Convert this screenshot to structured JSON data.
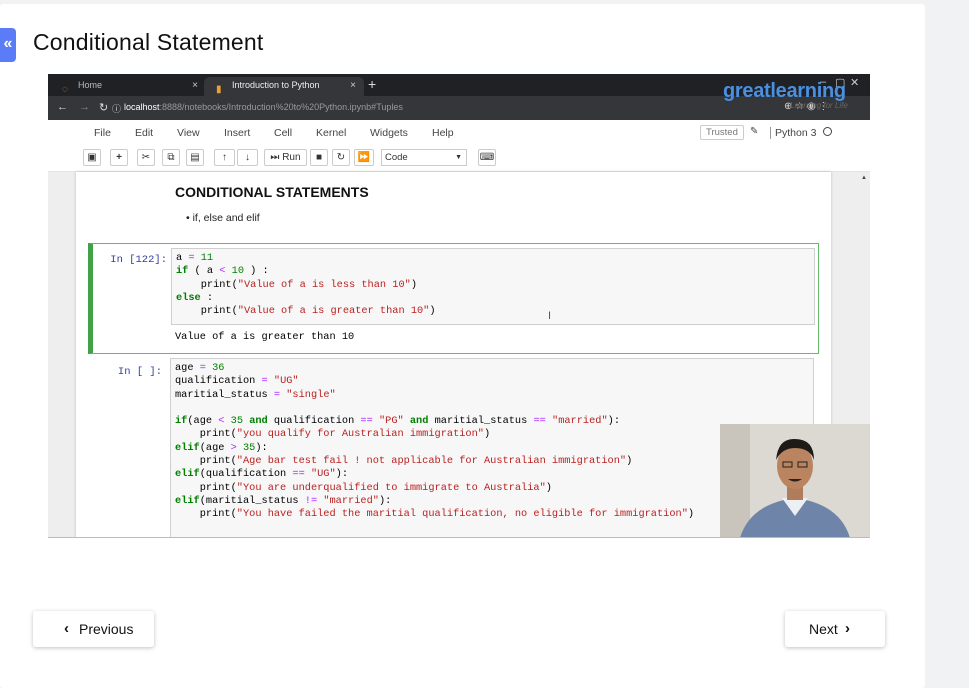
{
  "sidebar_toggle": {
    "glyph": "«"
  },
  "page": {
    "title": "Conditional Statement"
  },
  "browser": {
    "tabs": [
      {
        "label": "Home",
        "close": "×"
      },
      {
        "label": "Introduction to Python",
        "close": "×"
      }
    ],
    "new_tab": "+",
    "url_host": "localhost",
    "url_rest": ":8888/notebooks/Introduction%20to%20Python.ipynb#Tuples",
    "brand": "greatlearning",
    "brand_sub": "Learning for Life"
  },
  "jupyter": {
    "menu": [
      "File",
      "Edit",
      "View",
      "Insert",
      "Cell",
      "Kernel",
      "Widgets",
      "Help"
    ],
    "trusted": "Trusted",
    "kernel_name": "Python 3",
    "run_label": "Run",
    "cell_type": "Code",
    "heading": "CONDITIONAL STATEMENTS",
    "bullet": "if, else and elif",
    "cells": [
      {
        "prompt": "In [122]:",
        "output": "Value of a is greater than 10"
      },
      {
        "prompt": "In [ ]:"
      }
    ]
  },
  "navigation": {
    "previous": "Previous",
    "next": "Next"
  },
  "colors": {
    "accent": "#5b7cf7",
    "cell_selected": "#42a047",
    "brand": "#4a90e2"
  },
  "icons": [
    "double-chevron-left-icon",
    "chevron-left-icon",
    "chevron-right-icon",
    "pencil-icon",
    "keyboard-icon"
  ]
}
